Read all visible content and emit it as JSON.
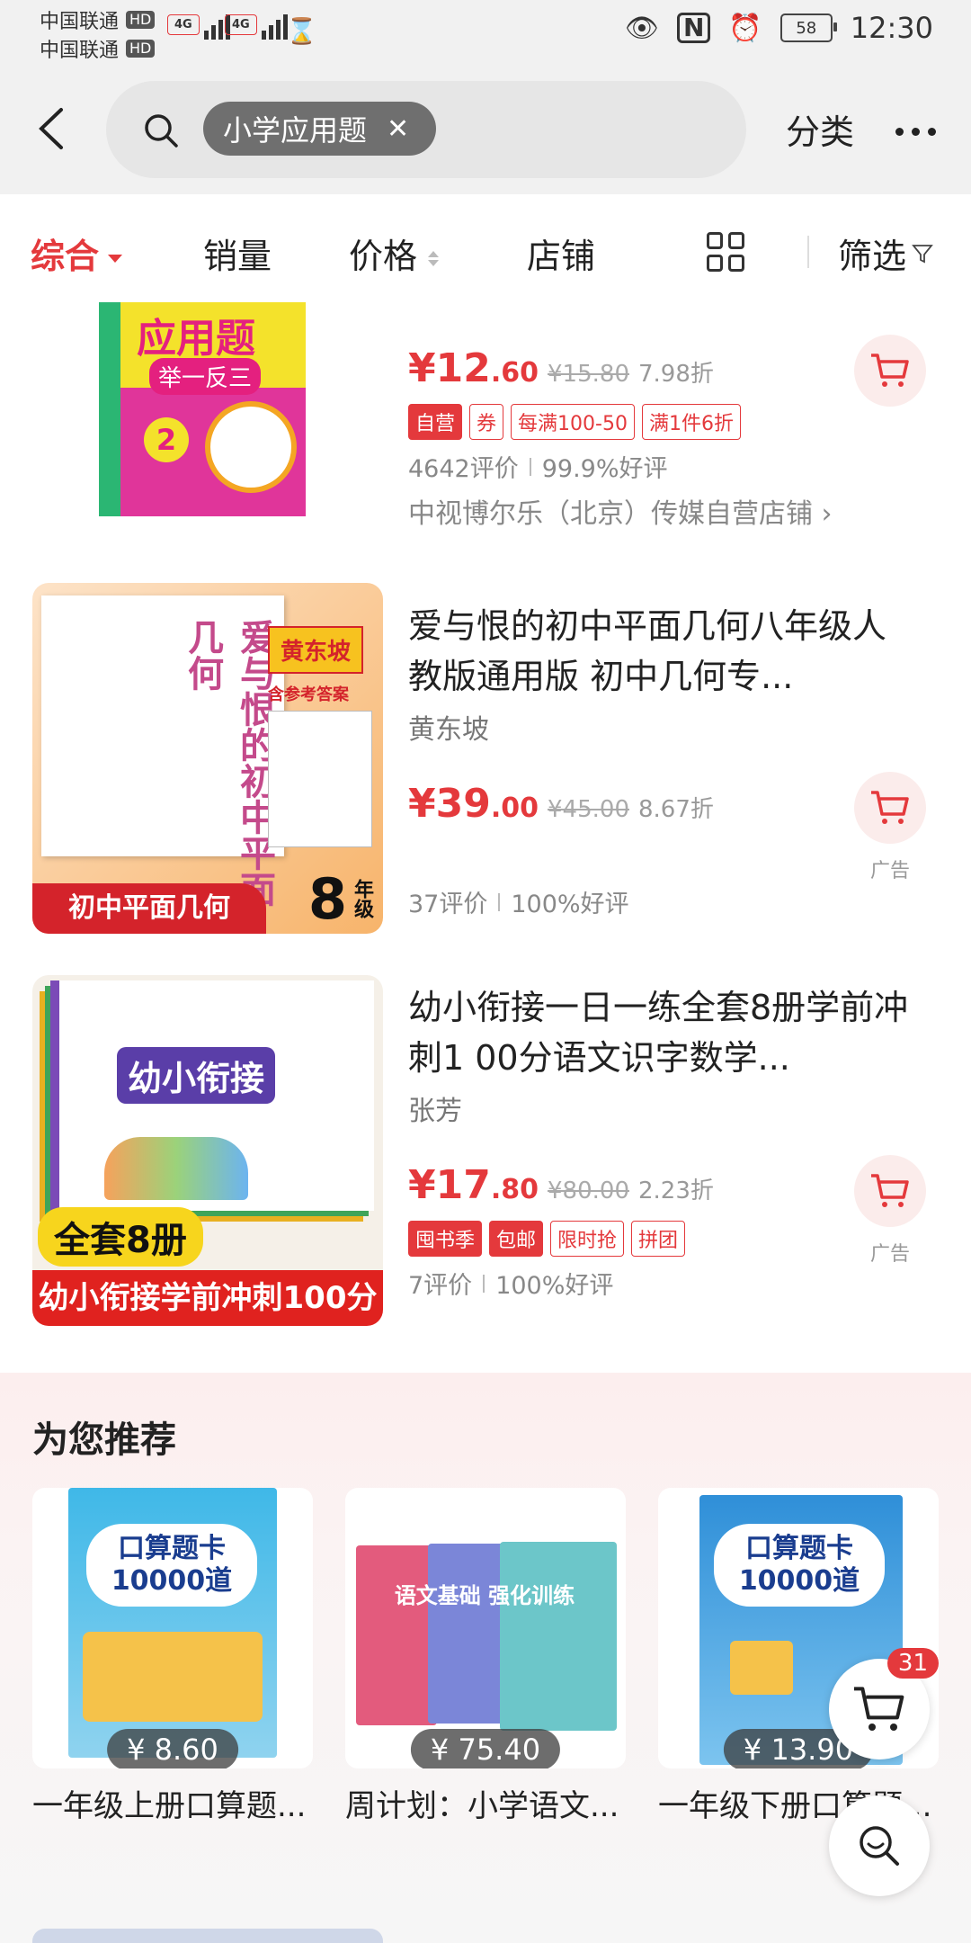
{
  "status": {
    "carrier1": "中国联通",
    "carrier2": "中国联通",
    "hd": "HD",
    "net": "4G",
    "battery": "58",
    "time": "12:30"
  },
  "search": {
    "query_chip": "小学应用题",
    "category_label": "分类"
  },
  "tabs": {
    "comprehensive": "综合",
    "sales": "销量",
    "price": "价格",
    "store": "店铺",
    "filter": "筛选"
  },
  "products": [
    {
      "cover_text": "应用题",
      "cover_sub": "举一反三",
      "price_int": "12",
      "price_dec": ".60",
      "orig_price": "¥15.80",
      "discount": "7.98折",
      "tags": [
        "自营",
        "券",
        "每满100-50",
        "满1件6折"
      ],
      "reviews": "4642评价",
      "rating": "99.9%好评",
      "shop": "中视博尔乐（北京）传媒自营店铺"
    },
    {
      "title": "爱与恨的初中平面几何八年级人教版通用版   初中几何专...",
      "author": "黄东坡",
      "cover_title": "爱与恨的初中平面几何",
      "cover_author": "黄东坡",
      "cover_note": "含参考答案",
      "cover_banner": "初中平面几何",
      "cover_grade": "8",
      "cover_grade_unit": "年级",
      "price_int": "39",
      "price_dec": ".00",
      "orig_price": "¥45.00",
      "discount": "8.67折",
      "ad": "广告",
      "reviews": "37评价",
      "rating": "100%好评"
    },
    {
      "title": "幼小衔接一日一练全套8册学前冲刺1  00分语文识字数学...",
      "author": "张芳",
      "cover_title": "幼小衔接",
      "cover_badge": "全套8册",
      "cover_banner": "幼小衔接学前冲刺100分",
      "price_int": "17",
      "price_dec": ".80",
      "orig_price": "¥80.00",
      "discount": "2.23折",
      "tags": [
        "囤书季",
        "包邮",
        "限时抢",
        "拼团"
      ],
      "ad": "广告",
      "reviews": "7评价",
      "rating": "100%好评"
    }
  ],
  "recommend": {
    "title": "为您推荐",
    "items": [
      {
        "name": "一年级上册口算题...",
        "price": "¥ 8.60",
        "cover": "口算题卡 10000道"
      },
      {
        "name": "周计划：小学语文...",
        "price": "¥ 75.40",
        "cover": "语文基础 强化训练"
      },
      {
        "name": "一年级下册口算题...",
        "price": "¥ 13.90",
        "cover": "口算题卡 10000道"
      }
    ]
  },
  "cart_badge": "31",
  "colors": {
    "accent": "#e4393c",
    "text": "#222222",
    "muted": "#888888"
  }
}
